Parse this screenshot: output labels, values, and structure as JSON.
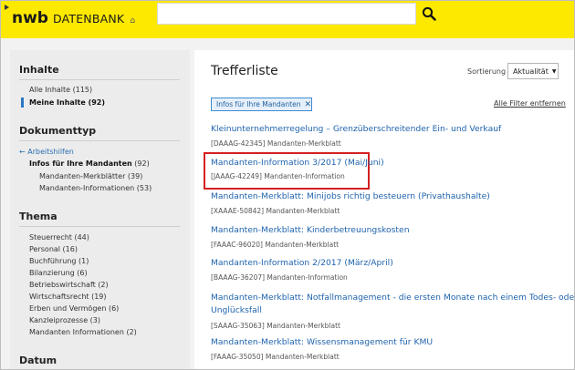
{
  "header": {
    "logo_main": "nwb",
    "logo_sub": "DATENBANK",
    "search_placeholder": ""
  },
  "sidebar": {
    "inhalte": {
      "heading": "Inhalte",
      "items": [
        {
          "label": "Alle Inhalte (115)"
        },
        {
          "label": "Meine Inhalte (92)"
        }
      ]
    },
    "dokumenttyp": {
      "heading": "Dokumenttyp",
      "back_label": "Arbeitshilfen",
      "current_label": "Infos für Ihre Mandanten",
      "current_count": "(92)",
      "subitems": [
        {
          "label": "Mandanten-Merkblätter (39)"
        },
        {
          "label": "Mandanten-Informationen (53)"
        }
      ]
    },
    "thema": {
      "heading": "Thema",
      "items": [
        {
          "label": "Steuerrecht (44)"
        },
        {
          "label": "Personal (16)"
        },
        {
          "label": "Buchführung (1)"
        },
        {
          "label": "Bilanzierung (6)"
        },
        {
          "label": "Betriebswirtschaft (2)"
        },
        {
          "label": "Wirtschaftsrecht (19)"
        },
        {
          "label": "Erben und Vermögen (6)"
        },
        {
          "label": "Kanzleiprozesse (3)"
        },
        {
          "label": "Mandanten Informationen (2)"
        }
      ]
    },
    "datum": {
      "heading": "Datum"
    }
  },
  "main": {
    "title": "Trefferliste",
    "sort_label": "Sortierung",
    "sort_value": "Aktualität",
    "active_filter": "Infos für Ihre Mandanten",
    "clear_filters": "Alle Filter entfernen",
    "results": [
      {
        "title": "Kleinunternehmerregelung – Grenzüberschreitender Ein- und Verkauf",
        "meta": "[DAAAG-42345] Mandanten-Merkblatt"
      },
      {
        "title": "Mandanten-Information 3/2017 (Mai/Juni)",
        "meta": "[JAAAG-42249] Mandanten-Information"
      },
      {
        "title": "Mandanten-Merkblatt: Minijobs richtig besteuern (Privathaushalte)",
        "meta": "[XAAAE-50842] Mandanten-Merkblatt"
      },
      {
        "title": "Mandanten-Merkblatt: Kinderbetreuungskosten",
        "meta": "[FAAAC-96020] Mandanten-Merkblatt"
      },
      {
        "title": "Mandanten-Information 2/2017 (März/April)",
        "meta": "[BAAAG-36207] Mandanten-Information"
      },
      {
        "title": "Mandanten-Merkblatt: Notfallmanagement - die ersten Monate nach einem Todes- oder",
        "title2": "Unglücksfall",
        "meta": "[SAAAG-35063] Mandanten-Merkblatt"
      },
      {
        "title": "Mandanten-Merkblatt: Wissensmanagement für KMU",
        "meta": "[FAAAG-35050] Mandanten-Merkblatt"
      }
    ]
  },
  "colors": {
    "brand_yellow": "#fde900",
    "link_blue": "#1f63ad",
    "highlight_red": "#d42020"
  }
}
